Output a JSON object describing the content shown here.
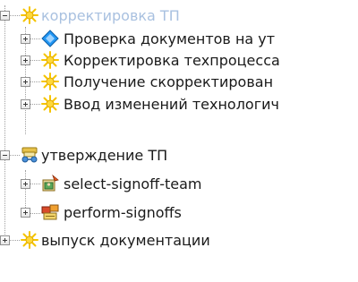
{
  "tree": {
    "root1": {
      "label": "корректировка ТП",
      "icon": "sun-star-icon",
      "selected": true,
      "children": [
        {
          "label": "Проверка документов на ут",
          "icon": "blue-diamond-icon"
        },
        {
          "label": "Корректировка техпроцесса",
          "icon": "sun-star-icon"
        },
        {
          "label": "Получение скорректирован",
          "icon": "sun-star-icon"
        },
        {
          "label": "Ввод изменений технологич",
          "icon": "sun-star-icon"
        }
      ]
    },
    "root2": {
      "label": "утверждение ТП",
      "icon": "approval-task-icon",
      "children": [
        {
          "label": "select-signoff-team",
          "icon": "select-team-icon"
        },
        {
          "label": "perform-signoffs",
          "icon": "perform-signoff-icon"
        }
      ]
    },
    "root3": {
      "label": "выпуск документации",
      "icon": "sun-star-icon"
    }
  },
  "colors": {
    "selected_text": "#a9c1e0",
    "star_yellow": "#f5c400",
    "diamond_blue": "#1e88e5"
  }
}
